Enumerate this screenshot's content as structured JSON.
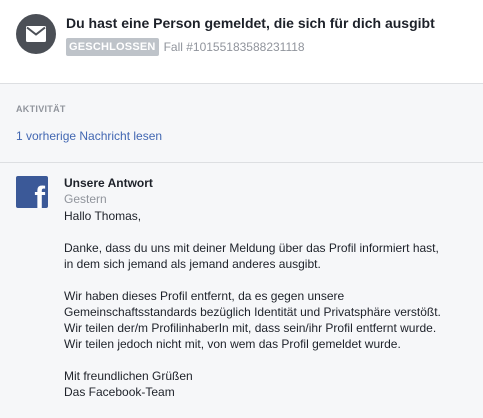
{
  "header": {
    "icon": "envelope-icon",
    "title": "Du hast eine Person gemeldet, die sich für dich ausgibt",
    "status": "GESCHLOSSEN",
    "case_number": "Fall #10155183588231118"
  },
  "activity": {
    "label": "AKTIVITÄT",
    "previous_link": "1 vorherige Nachricht lesen"
  },
  "message": {
    "avatar_icon": "facebook-logo-icon",
    "avatar_letter": "f",
    "sender": "Unsere Antwort",
    "timestamp": "Gestern",
    "greeting": "Hallo Thomas,",
    "paragraph1": [
      "Danke, dass du uns mit deiner Meldung über das Profil informiert hast,",
      "in dem sich jemand als jemand anderes ausgibt."
    ],
    "paragraph2": [
      "Wir haben dieses Profil entfernt, da es gegen unsere",
      "Gemeinschaftsstandards bezüglich Identität und Privatsphäre verstößt.",
      "Wir teilen der/m ProfilinhaberIn mit, dass sein/ihr Profil entfernt wurde.",
      "Wir teilen jedoch nicht mit, von wem das Profil gemeldet wurde."
    ],
    "closing": [
      "Mit freundlichen Grüßen",
      "Das Facebook-Team"
    ]
  },
  "colors": {
    "link": "#4267b2",
    "muted_text": "#90949c",
    "badge_bg": "#bec3c9",
    "panel_bg": "#f6f7f9",
    "facebook_blue": "#3b5998",
    "icon_circle": "#4b4f56"
  }
}
